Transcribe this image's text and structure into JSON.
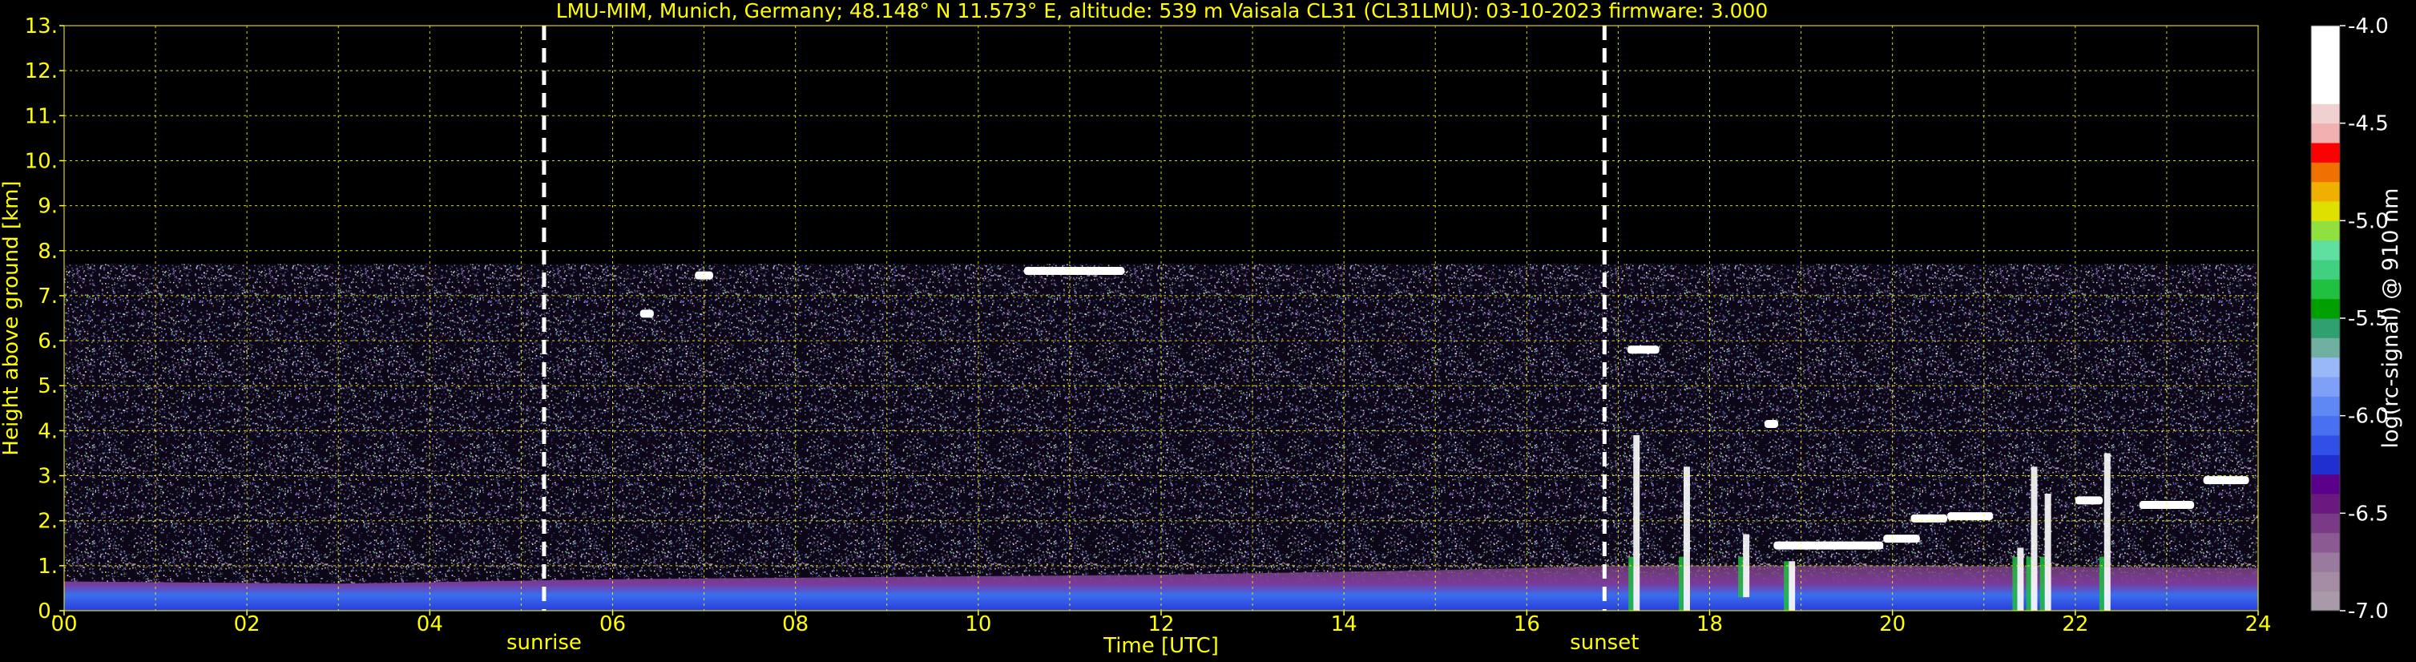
{
  "chart_data": {
    "type": "heatmap",
    "title": "LMU-MIM, Munich, Germany; 48.148° N 11.573° E, altitude: 539 m    Vaisala CL31 (CL31LMU): 03-10-2023    firmware: 3.000",
    "xlabel": "Time [UTC]",
    "ylabel": "Height above ground [km]",
    "xlim": [
      0,
      24
    ],
    "ylim": [
      0,
      13
    ],
    "x_ticks": [
      "00",
      "02",
      "04",
      "06",
      "08",
      "10",
      "12",
      "14",
      "16",
      "18",
      "20",
      "22",
      "24"
    ],
    "y_ticks": [
      "0.",
      "1.",
      "2.",
      "3.",
      "4.",
      "5.",
      "6.",
      "7.",
      "8.",
      "9.",
      "10.",
      "11.",
      "12.",
      "13."
    ],
    "grid": true,
    "grid_minor_x_step_hours": 1,
    "grid_y_step_km": 1,
    "signal_top_km": 7.7,
    "markers": [
      {
        "label": "sunrise",
        "time_h": 5.25
      },
      {
        "label": "sunset",
        "time_h": 16.85
      }
    ],
    "boundary_layer": [
      {
        "t": 0,
        "h": 0.65
      },
      {
        "t": 3,
        "h": 0.6
      },
      {
        "t": 6,
        "h": 0.7
      },
      {
        "t": 9,
        "h": 0.75
      },
      {
        "t": 12,
        "h": 0.8
      },
      {
        "t": 15,
        "h": 0.9
      },
      {
        "t": 17,
        "h": 1.0
      },
      {
        "t": 20,
        "h": 1.0
      },
      {
        "t": 24,
        "h": 0.95
      }
    ],
    "cloud_segments": [
      {
        "t0": 6.9,
        "t1": 7.1,
        "h": 7.45
      },
      {
        "t0": 10.5,
        "t1": 11.6,
        "h": 7.55
      },
      {
        "t0": 6.3,
        "t1": 6.45,
        "h": 6.6
      },
      {
        "t0": 17.1,
        "t1": 17.45,
        "h": 5.8
      },
      {
        "t0": 18.6,
        "t1": 18.75,
        "h": 4.15
      },
      {
        "t0": 18.7,
        "t1": 19.9,
        "h": 1.45
      },
      {
        "t0": 19.9,
        "t1": 20.3,
        "h": 1.6
      },
      {
        "t0": 20.2,
        "t1": 20.6,
        "h": 2.05
      },
      {
        "t0": 20.6,
        "t1": 21.1,
        "h": 2.1
      },
      {
        "t0": 22.0,
        "t1": 22.3,
        "h": 2.45
      },
      {
        "t0": 22.7,
        "t1": 23.3,
        "h": 2.35
      },
      {
        "t0": 23.4,
        "t1": 23.9,
        "h": 2.9
      }
    ],
    "cloud_columns": [
      {
        "t": 17.2,
        "h0": 0.0,
        "h1": 3.9
      },
      {
        "t": 17.75,
        "h0": 0.0,
        "h1": 3.2
      },
      {
        "t": 18.4,
        "h0": 0.3,
        "h1": 1.7
      },
      {
        "t": 18.9,
        "h0": 0.0,
        "h1": 1.1
      },
      {
        "t": 21.4,
        "h0": 0.0,
        "h1": 1.4
      },
      {
        "t": 21.55,
        "h0": 0.0,
        "h1": 3.2
      },
      {
        "t": 21.7,
        "h0": 0.0,
        "h1": 2.6
      },
      {
        "t": 22.35,
        "h0": 0.0,
        "h1": 3.5
      }
    ],
    "colorbar": {
      "label": "log(rc-signal) @ 910 nm",
      "range": [
        -7.0,
        -4.0
      ],
      "ticks": [
        "-4.0",
        "-4.5",
        "-5.0",
        "-5.5",
        "-6.0",
        "-6.5",
        "-7.0"
      ],
      "colors": [
        "#a89aa8",
        "#a48ca4",
        "#9a7a9e",
        "#8c5a92",
        "#7a3a86",
        "#6a1a7e",
        "#5a008a",
        "#2030d0",
        "#3050e8",
        "#4870f0",
        "#6088f5",
        "#80a0f8",
        "#98b8f8",
        "#70b0a0",
        "#30a070",
        "#00a000",
        "#20c040",
        "#40d080",
        "#60e0a0",
        "#90e040",
        "#e0e000",
        "#f0b000",
        "#f07000",
        "#ff0000",
        "#f0b0b0",
        "#f0d0d0",
        "#ffffff",
        "#ffffff",
        "#ffffff",
        "#ffffff"
      ]
    }
  }
}
